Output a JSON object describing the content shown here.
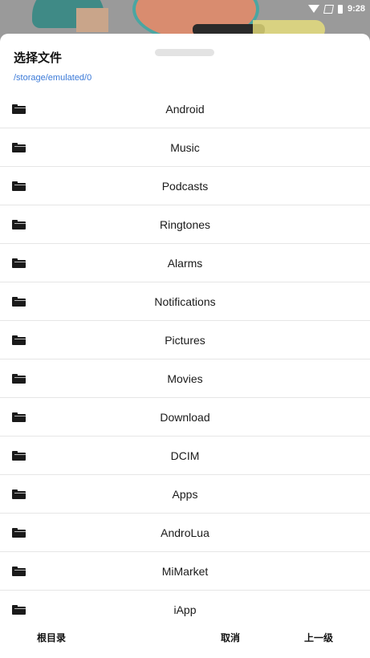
{
  "status_bar": {
    "time": "9:28",
    "icons": [
      "wifi-icon",
      "no-sim-icon",
      "battery-icon"
    ]
  },
  "dialog": {
    "title": "选择文件",
    "path": "/storage/emulated/0",
    "items": [
      {
        "label": "Android",
        "icon": "folder-icon"
      },
      {
        "label": "Music",
        "icon": "folder-icon"
      },
      {
        "label": "Podcasts",
        "icon": "folder-icon"
      },
      {
        "label": "Ringtones",
        "icon": "folder-icon"
      },
      {
        "label": "Alarms",
        "icon": "folder-icon"
      },
      {
        "label": "Notifications",
        "icon": "folder-icon"
      },
      {
        "label": "Pictures",
        "icon": "folder-icon"
      },
      {
        "label": "Movies",
        "icon": "folder-icon"
      },
      {
        "label": "Download",
        "icon": "folder-icon"
      },
      {
        "label": "DCIM",
        "icon": "folder-icon"
      },
      {
        "label": "Apps",
        "icon": "folder-icon"
      },
      {
        "label": "AndroLua",
        "icon": "folder-icon"
      },
      {
        "label": "MiMarket",
        "icon": "folder-icon"
      },
      {
        "label": "iApp",
        "icon": "folder-icon"
      }
    ],
    "buttons": {
      "root": "根目录",
      "cancel": "取消",
      "up": "上一级"
    }
  },
  "colors": {
    "path_link": "#3b7ad8",
    "divider": "#e6e6e6",
    "scrim": "#8e8e8e"
  }
}
